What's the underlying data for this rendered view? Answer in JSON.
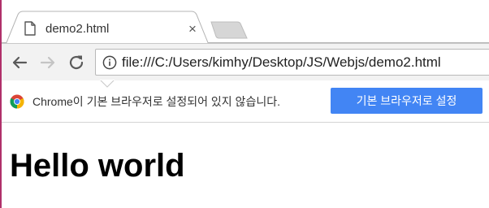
{
  "tab": {
    "title": "demo2.html",
    "close_glyph": "×",
    "favicon_icon": "page-icon"
  },
  "toolbar": {
    "back_icon": "arrow-left-icon",
    "forward_icon": "arrow-right-icon",
    "reload_icon": "reload-icon",
    "url": "file:///C:/Users/kimhy/Desktop/JS/Webjs/demo2.html",
    "site_info_icon": "info-icon"
  },
  "infobar": {
    "message": "Chrome이 기본 브라우저로 설정되어 있지 않습니다.",
    "button_label": "기본 브라우저로 설정",
    "logo_icon": "chrome-logo-icon"
  },
  "page": {
    "heading": "Hello world"
  },
  "colors": {
    "accent_button": "#4285f4",
    "toolbar_bg": "#f2f2f2",
    "left_edge": "#b0306a"
  }
}
